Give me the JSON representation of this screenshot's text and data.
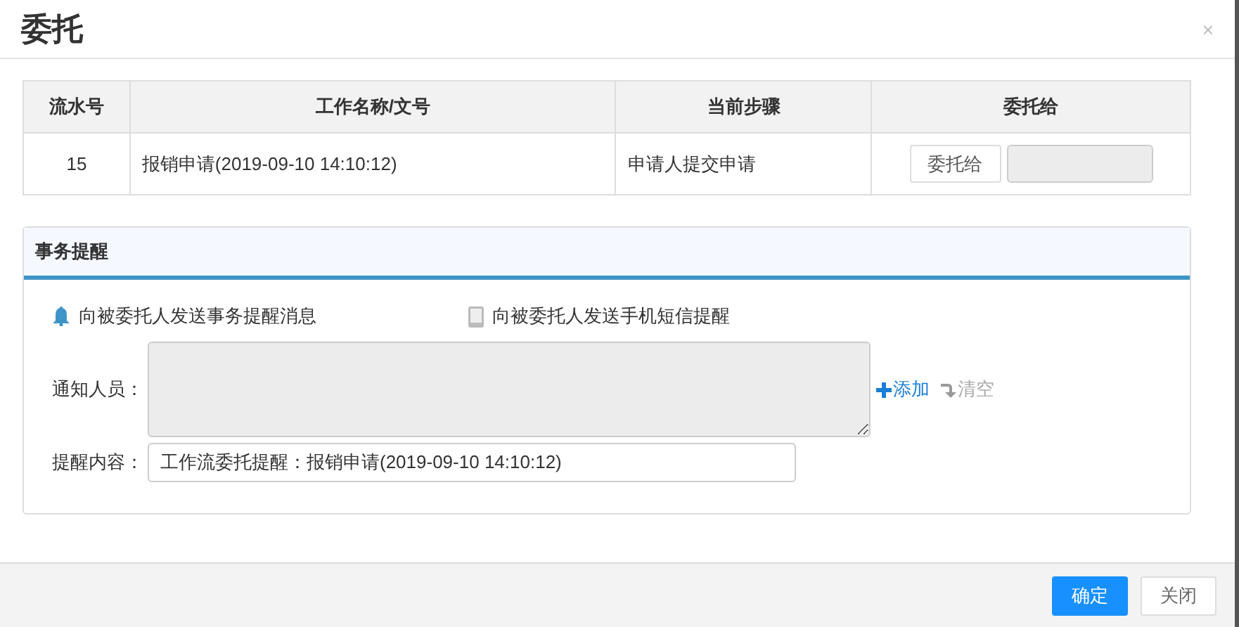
{
  "dialog": {
    "title": "委托",
    "close": "×"
  },
  "table": {
    "columns": [
      "流水号",
      "工作名称/文号",
      "当前步骤",
      "委托给"
    ],
    "rows": [
      {
        "cells": [
          "15",
          "报销申请(2019-09-10 14:10:12)",
          "申请人提交申请"
        ],
        "button": "委托给"
      }
    ]
  },
  "reminder": {
    "title": "事务提醒",
    "options": [
      {
        "kind": "bell",
        "label": "向被委托人发送事务提醒消息",
        "on": true
      },
      {
        "kind": "phone",
        "label": "向被委托人发送手机短信提醒",
        "on": false
      }
    ],
    "notify_label": "通知人员：",
    "add": "添加",
    "clear": "清空",
    "content_label": "提醒内容：",
    "content_value": "工作流委托提醒：报销申请(2019-09-10 14:10:12)"
  },
  "buttons": [
    {
      "label": "确定",
      "kind": "primary"
    },
    {
      "label": "关闭",
      "kind": "default"
    }
  ]
}
